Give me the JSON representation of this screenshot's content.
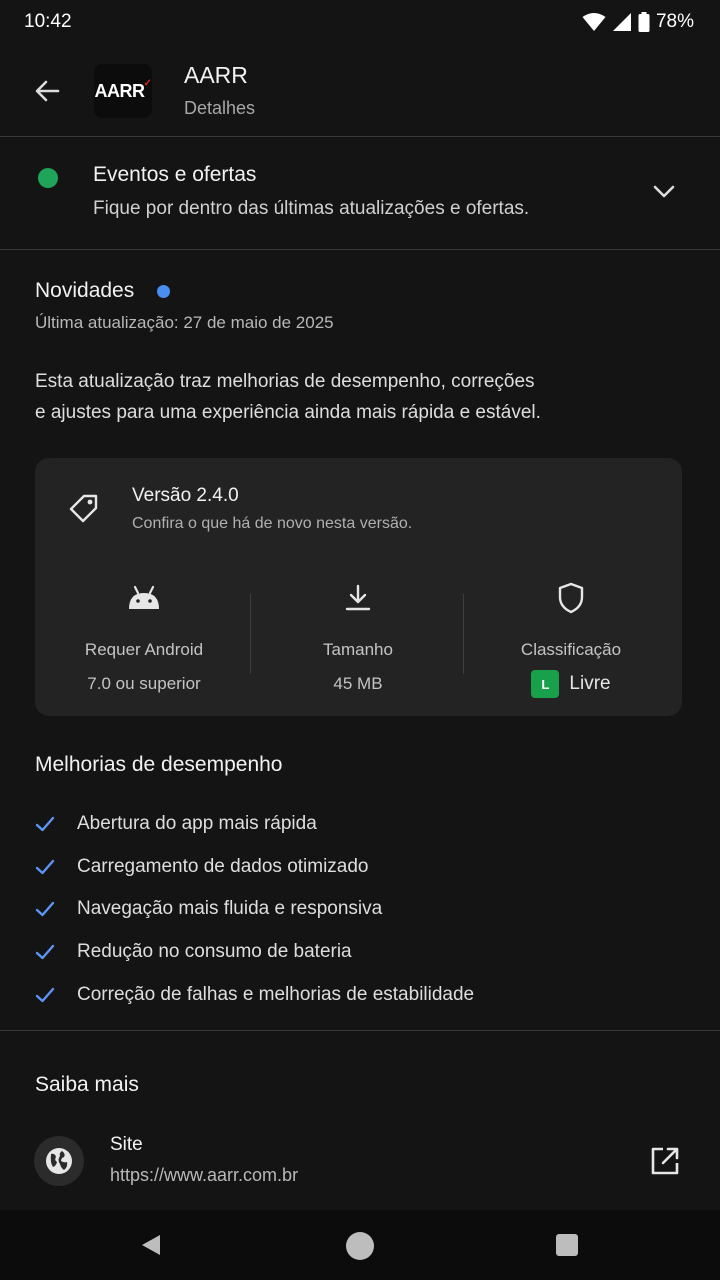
{
  "status": {
    "time": "10:42",
    "battery": "78%"
  },
  "header": {
    "logo_text": "AARR",
    "title": "AARR",
    "subtitle": "Detalhes"
  },
  "events": {
    "title": "Eventos e ofertas",
    "description": "Fique por dentro das últimas atualizações e ofertas.",
    "indicator_color": "#1fa45a"
  },
  "news": {
    "title": "Novidades",
    "updated": "Última atualização: 27 de maio de 2025",
    "body_line1": "Esta atualização traz melhorias de desempenho, correções",
    "body_line2": "e ajustes para uma experiência ainda mais rápida e estável.",
    "dot_color": "#4a8df0"
  },
  "version_card": {
    "title": "Versão 2.4.0",
    "subtitle": "Confira o que há de novo nesta versão.",
    "stats": [
      {
        "icon": "android-icon",
        "label": "Requer Android",
        "value": "7.0 ou superior"
      },
      {
        "icon": "download-icon",
        "label": "Tamanho",
        "value": "45 MB"
      },
      {
        "icon": "shield-icon",
        "label": "Classificação",
        "badge": "L",
        "value": "Livre"
      }
    ]
  },
  "improvements": {
    "title": "Melhorias de desempenho",
    "items": [
      "Abertura do app mais rápida",
      "Carregamento de dados otimizado",
      "Navegação mais fluida e responsiva",
      "Redução no consumo de bateria",
      "Correção de falhas e melhorias de estabilidade"
    ]
  },
  "more": {
    "title": "Saiba mais",
    "site_label": "Site",
    "site_url": "https://www.aarr.com.br"
  },
  "colors": {
    "accent": "#4a8df0",
    "rating_green": "#18a04a",
    "background": "#141414"
  }
}
